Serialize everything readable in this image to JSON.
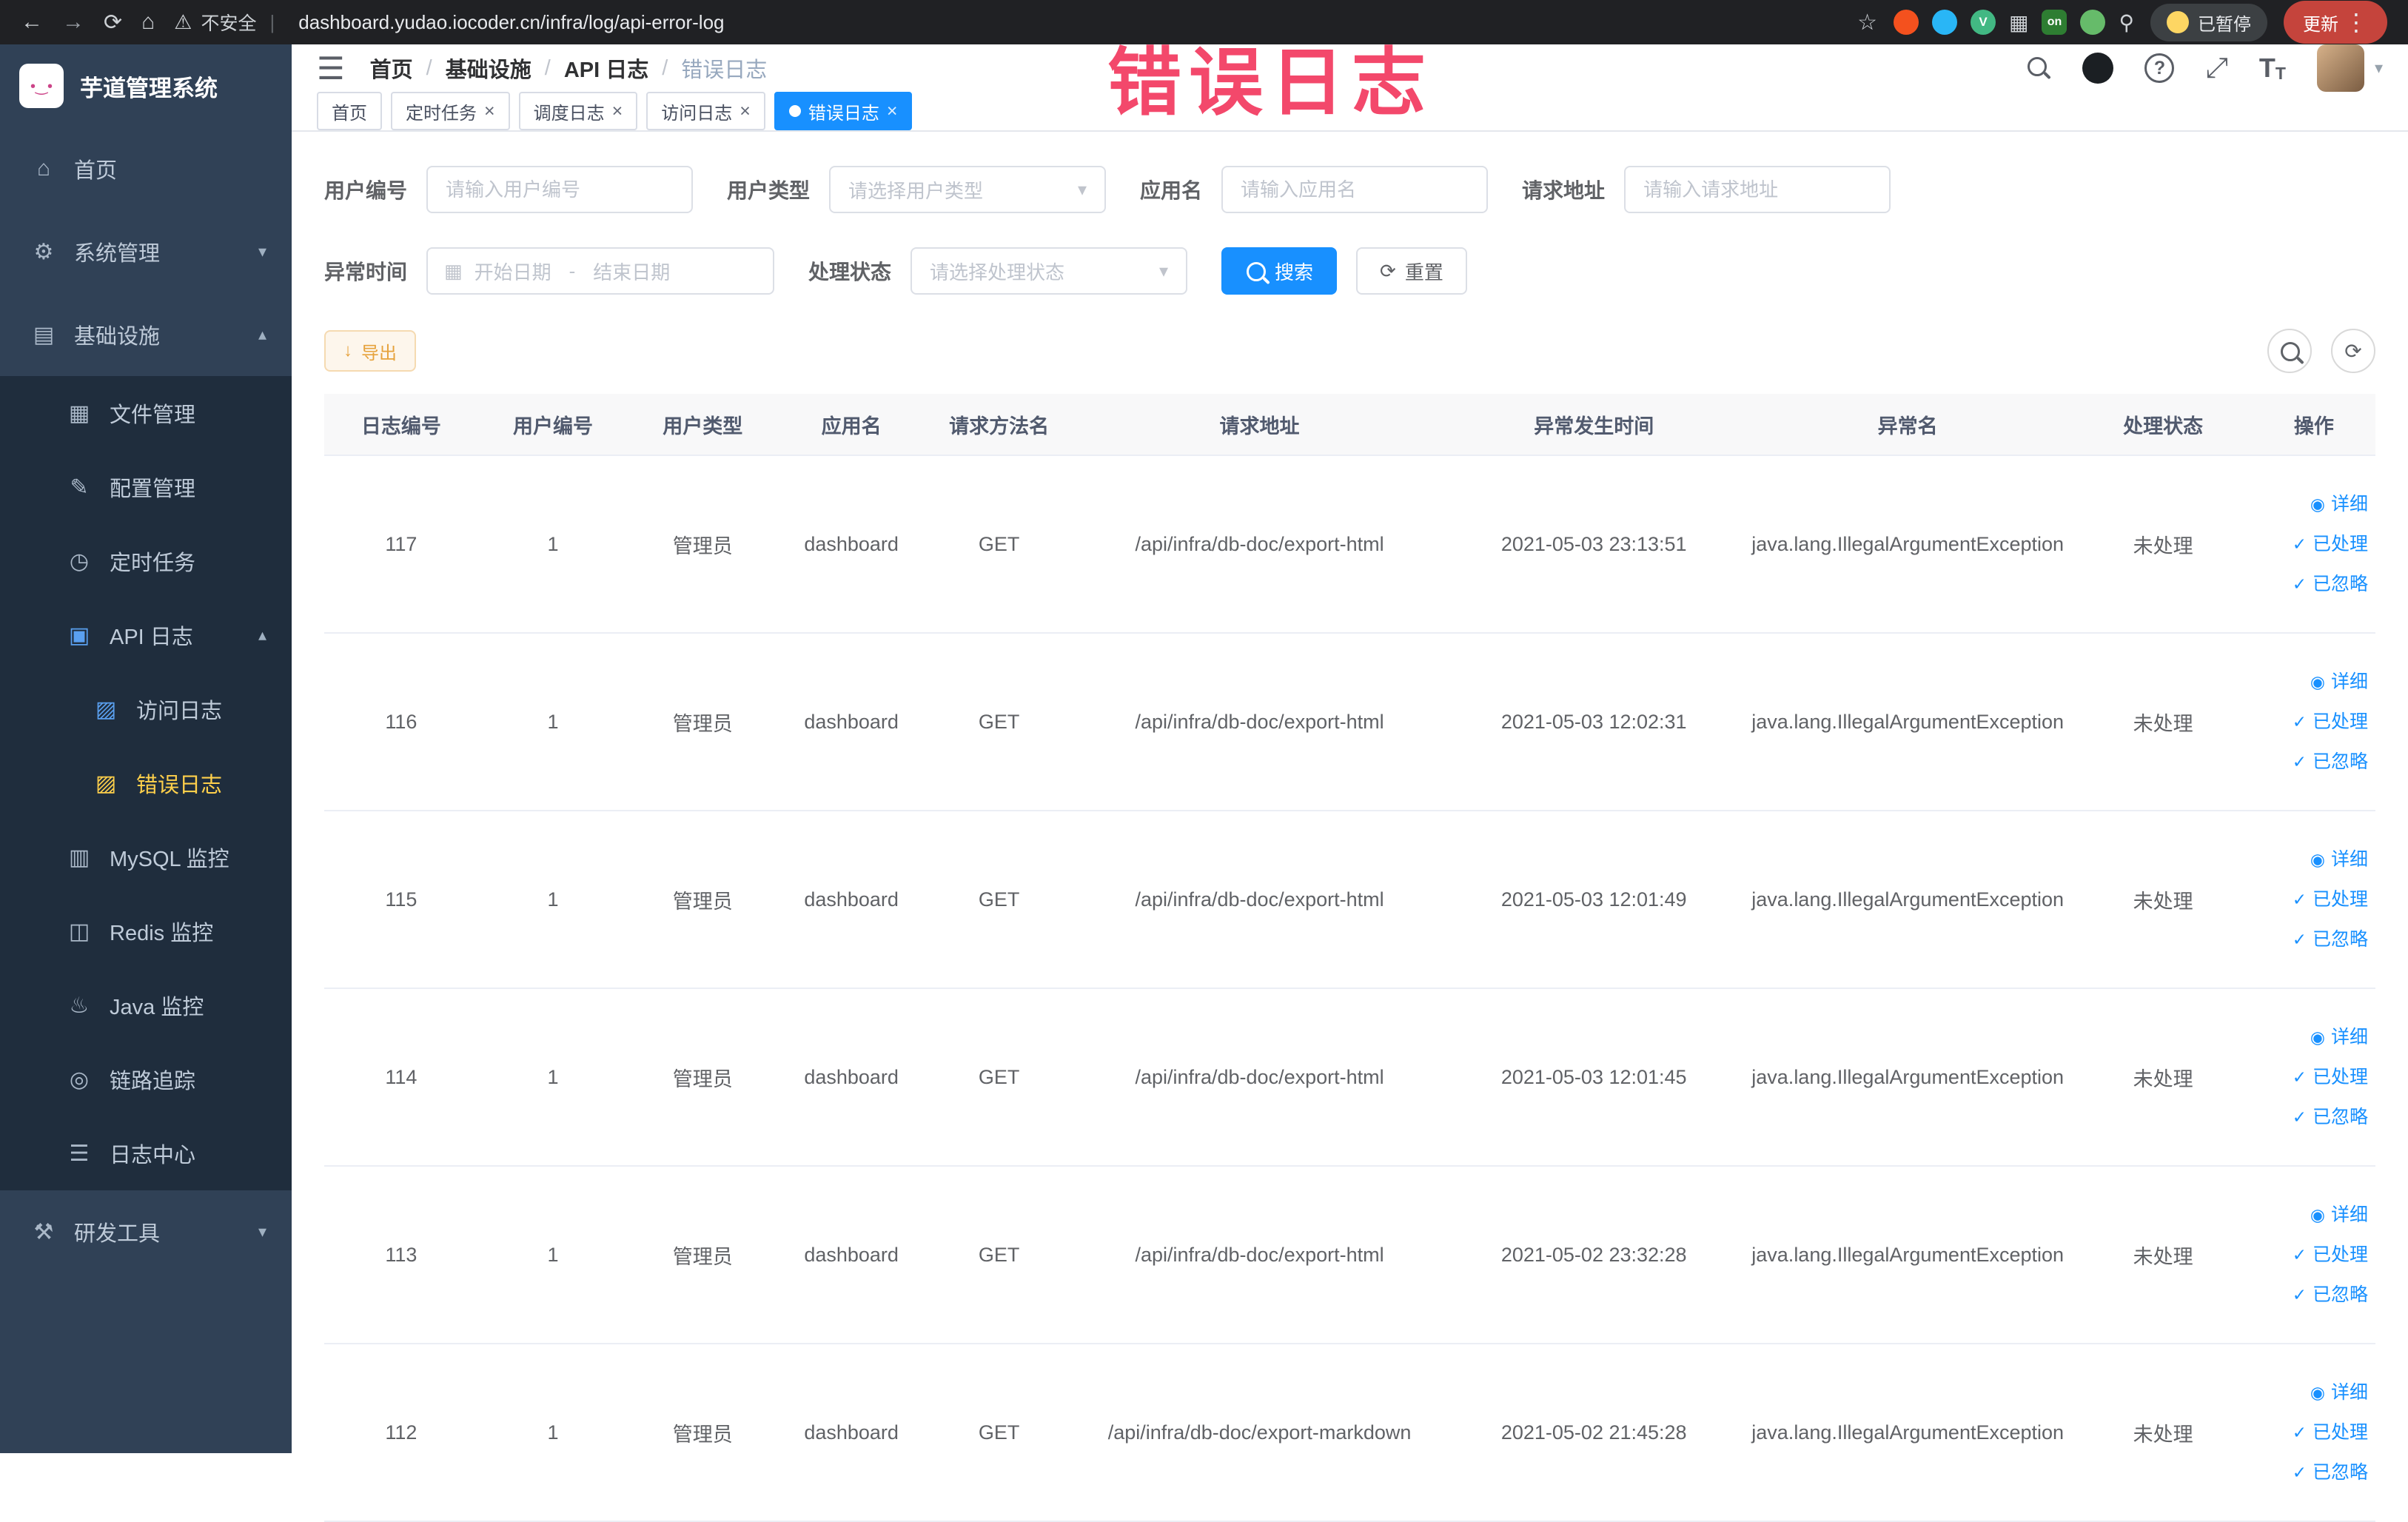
{
  "browser": {
    "security_label": "不安全",
    "url": "dashboard.yudao.iocoder.cn/infra/log/api-error-log",
    "paused_label": "已暂停",
    "update_label": "更新",
    "extensions": [
      {
        "name": "devtools",
        "color": "#f4511e"
      },
      {
        "name": "water-drop",
        "color": "#29b6f6"
      },
      {
        "name": "vue",
        "color": "#42b883",
        "letter": "V"
      },
      {
        "name": "extensions-puzzle",
        "glyph": "▦"
      },
      {
        "name": "on-badge",
        "color": "#2e7d32",
        "letter": "on",
        "badge": true
      },
      {
        "name": "leaf",
        "color": "#66bb6a"
      },
      {
        "name": "pin",
        "glyph": "⚲"
      }
    ]
  },
  "icons": {
    "home": "⌂",
    "gear": "⚙",
    "infra": "▤",
    "file": "▦",
    "config": "✎",
    "timer": "◷",
    "apilog": "▣",
    "doc": "▨",
    "mysql": "▥",
    "redis": "◫",
    "java": "♨",
    "trace": "◎",
    "logcenter": "☰",
    "devtools": "⚒",
    "chevron-down": "▾",
    "chevron-up": "▴",
    "calendar": "▦",
    "download": "↓",
    "refresh": "⟳",
    "check": "✓",
    "eye": "◉",
    "close": "×",
    "star": "☆",
    "warning": "⚠",
    "kebab": "⋮",
    "back": "←",
    "forward": "→",
    "reload": "⟳",
    "home-btn": "⌂",
    "fullscreen": "⤢",
    "caret-down": "▾",
    "hamburger": "☰"
  },
  "colors": {
    "primary": "#1890ff",
    "sidebar": "#304156",
    "submenu": "#1f2d3d",
    "active_menu_text": "#ffd04b",
    "annotation": "#f3486b",
    "export_text": "#e6a23c"
  },
  "sidebar": {
    "logo_title": "芋道管理系统",
    "items": [
      {
        "key": "home",
        "label": "首页",
        "icon": "home",
        "level": 1
      },
      {
        "key": "system",
        "label": "系统管理",
        "icon": "gear",
        "level": 1,
        "arrow": "down"
      },
      {
        "key": "infra",
        "label": "基础设施",
        "icon": "infra",
        "level": 1,
        "arrow": "up"
      },
      {
        "key": "file",
        "label": "文件管理",
        "icon": "file",
        "level": 2
      },
      {
        "key": "config",
        "label": "配置管理",
        "icon": "config",
        "level": 2
      },
      {
        "key": "job",
        "label": "定时任务",
        "icon": "timer",
        "level": 2
      },
      {
        "key": "api-log",
        "label": "API 日志",
        "icon": "apilog",
        "level": 2,
        "arrow": "up",
        "iconColor": "#5aa0f0"
      },
      {
        "key": "access-log",
        "label": "访问日志",
        "icon": "doc",
        "level": 3,
        "iconColor": "#5aa0f0"
      },
      {
        "key": "error-log",
        "label": "错误日志",
        "icon": "doc",
        "level": 3,
        "active": true,
        "iconColor": "#ffd04b"
      },
      {
        "key": "mysql",
        "label": "MySQL 监控",
        "icon": "mysql",
        "level": 2
      },
      {
        "key": "redis",
        "label": "Redis 监控",
        "icon": "redis",
        "level": 2
      },
      {
        "key": "java",
        "label": "Java 监控",
        "icon": "java",
        "level": 2
      },
      {
        "key": "trace",
        "label": "链路追踪",
        "icon": "trace",
        "level": 2
      },
      {
        "key": "log-center",
        "label": "日志中心",
        "icon": "logcenter",
        "level": 2
      },
      {
        "key": "dev-tools",
        "label": "研发工具",
        "icon": "devtools",
        "level": 1,
        "arrow": "down"
      }
    ]
  },
  "header": {
    "breadcrumb": [
      "首页",
      "基础设施",
      "API 日志",
      "错误日志"
    ]
  },
  "tabs": [
    {
      "label": "首页",
      "closable": false,
      "active": false
    },
    {
      "label": "定时任务",
      "closable": true,
      "active": false
    },
    {
      "label": "调度日志",
      "closable": true,
      "active": false
    },
    {
      "label": "访问日志",
      "closable": true,
      "active": false
    },
    {
      "label": "错误日志",
      "closable": true,
      "active": true
    }
  ],
  "annotation": {
    "text": "错误日志"
  },
  "filters": {
    "user_id": {
      "label": "用户编号",
      "placeholder": "请输入用户编号"
    },
    "user_type": {
      "label": "用户类型",
      "placeholder": "请选择用户类型"
    },
    "app_name": {
      "label": "应用名",
      "placeholder": "请输入应用名"
    },
    "request_url": {
      "label": "请求地址",
      "placeholder": "请输入请求地址"
    },
    "exception_time": {
      "label": "异常时间",
      "start_placeholder": "开始日期",
      "separator": "-",
      "end_placeholder": "结束日期"
    },
    "process_status": {
      "label": "处理状态",
      "placeholder": "请选择处理状态"
    },
    "search_label": "搜索",
    "reset_label": "重置"
  },
  "toolbar": {
    "export_label": "导出"
  },
  "table": {
    "columns": [
      "日志编号",
      "用户编号",
      "用户类型",
      "应用名",
      "请求方法名",
      "请求地址",
      "异常发生时间",
      "异常名",
      "处理状态",
      "操作"
    ],
    "col_widths": [
      "7.5%",
      "7.3%",
      "7.3%",
      "7.2%",
      "7.2%",
      "18.2%",
      "14.4%",
      "16.2%",
      "8.7%",
      "6.0%"
    ],
    "rows": [
      {
        "log_id": "117",
        "user_id": "1",
        "user_type": "管理员",
        "app_name": "dashboard",
        "method": "GET",
        "url": "/api/infra/db-doc/export-html",
        "time": "2021-05-03 23:13:51",
        "exception": "java.lang.IllegalArgumentException",
        "status": "未处理"
      },
      {
        "log_id": "116",
        "user_id": "1",
        "user_type": "管理员",
        "app_name": "dashboard",
        "method": "GET",
        "url": "/api/infra/db-doc/export-html",
        "time": "2021-05-03 12:02:31",
        "exception": "java.lang.IllegalArgumentException",
        "status": "未处理"
      },
      {
        "log_id": "115",
        "user_id": "1",
        "user_type": "管理员",
        "app_name": "dashboard",
        "method": "GET",
        "url": "/api/infra/db-doc/export-html",
        "time": "2021-05-03 12:01:49",
        "exception": "java.lang.IllegalArgumentException",
        "status": "未处理"
      },
      {
        "log_id": "114",
        "user_id": "1",
        "user_type": "管理员",
        "app_name": "dashboard",
        "method": "GET",
        "url": "/api/infra/db-doc/export-html",
        "time": "2021-05-03 12:01:45",
        "exception": "java.lang.IllegalArgumentException",
        "status": "未处理"
      },
      {
        "log_id": "113",
        "user_id": "1",
        "user_type": "管理员",
        "app_name": "dashboard",
        "method": "GET",
        "url": "/api/infra/db-doc/export-html",
        "time": "2021-05-02 23:32:28",
        "exception": "java.lang.IllegalArgumentException",
        "status": "未处理"
      },
      {
        "log_id": "112",
        "user_id": "1",
        "user_type": "管理员",
        "app_name": "dashboard",
        "method": "GET",
        "url": "/api/infra/db-doc/export-markdown",
        "time": "2021-05-02 21:45:28",
        "exception": "java.lang.IllegalArgumentException",
        "status": "未处理"
      }
    ],
    "row_actions": [
      {
        "key": "detail-link",
        "icon": "eye",
        "label": "详细"
      },
      {
        "key": "processed-link",
        "icon": "check",
        "label": "已处理"
      },
      {
        "key": "ignored-link",
        "icon": "check",
        "label": "已忽略"
      }
    ]
  }
}
